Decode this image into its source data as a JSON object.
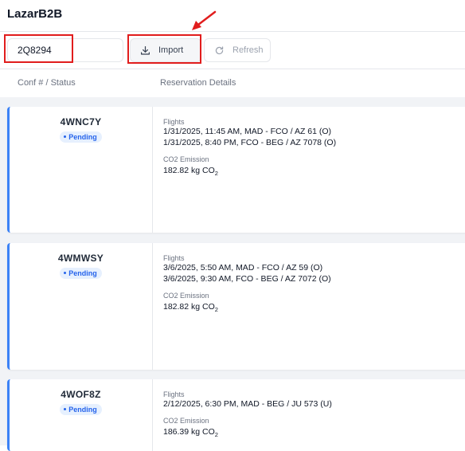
{
  "app": {
    "title": "LazarB2B"
  },
  "toolbar": {
    "conf_input_value": "2Q8294",
    "import_label": "Import",
    "refresh_label": "Refresh"
  },
  "columns": {
    "conf": "Conf # / Status",
    "details": "Reservation Details"
  },
  "reservations": [
    {
      "conf": "4WNC7Y",
      "status": "Pending",
      "flights_label": "Flights",
      "flights": [
        "1/31/2025, 11:45 AM, MAD - FCO / AZ 61 (O)",
        "1/31/2025, 8:40 PM, FCO - BEG / AZ 7078 (O)"
      ],
      "co2_label": "CO2 Emission",
      "co2_value": "182.82 kg CO",
      "co2_sub": "2"
    },
    {
      "conf": "4WMWSY",
      "status": "Pending",
      "flights_label": "Flights",
      "flights": [
        "3/6/2025, 5:50 AM, MAD - FCO / AZ 59 (O)",
        "3/6/2025, 9:30 AM, FCO - BEG / AZ 7072 (O)"
      ],
      "co2_label": "CO2 Emission",
      "co2_value": "182.82 kg CO",
      "co2_sub": "2"
    },
    {
      "conf": "4WOF8Z",
      "status": "Pending",
      "flights_label": "Flights",
      "flights": [
        "2/12/2025, 6:30 PM, MAD - BEG / JU 573 (U)"
      ],
      "co2_label": "CO2 Emission",
      "co2_value": "186.39 kg CO",
      "co2_sub": "2"
    }
  ],
  "colors": {
    "accent": "#3b82f6",
    "annotation": "#e11d1d",
    "pending_badge_bg": "#e6f0fe",
    "pending_badge_text": "#2563eb"
  },
  "icons": {
    "import": "download-icon",
    "refresh": "refresh-icon"
  }
}
